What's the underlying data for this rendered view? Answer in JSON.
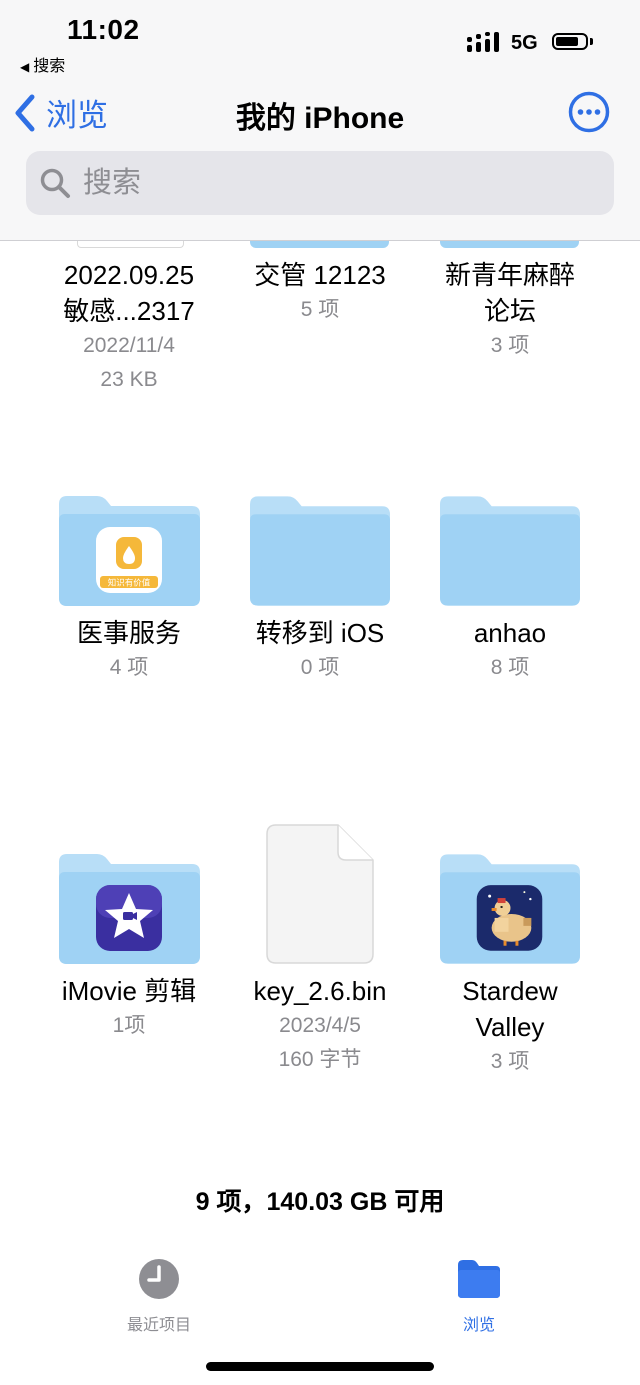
{
  "status_bar": {
    "time": "11:02",
    "back_app": "搜索",
    "network": "5G"
  },
  "nav": {
    "back_label": "浏览",
    "title": "我的 iPhone",
    "more_icon": "ellipsis-circle-icon"
  },
  "search": {
    "placeholder": "搜索",
    "value": ""
  },
  "items": [
    {
      "name_line1": "2022.09.25",
      "name_line2": "敏感...2317",
      "meta1": "2022/11/4",
      "meta2": "23 KB"
    },
    {
      "name_line1": "交管 12123",
      "meta1": "5 项"
    },
    {
      "name_line1": "新青年麻醉",
      "name_line2": "论坛",
      "meta1": "3 项"
    },
    {
      "name_line1": "医事服务",
      "meta1": "4 项",
      "badge": "知识有价值"
    },
    {
      "name_line1": "转移到 iOS",
      "meta1": "0 项"
    },
    {
      "name_line1": "anhao",
      "meta1": "8 项"
    },
    {
      "name_line1": "iMovie 剪辑",
      "meta1": "1项"
    },
    {
      "name_line1": "key_2.6.bin",
      "meta1": "2023/4/5",
      "meta2": "160 字节"
    },
    {
      "name_line1": "Stardew",
      "name_line2": "Valley",
      "meta1": "3 项"
    }
  ],
  "footer": {
    "storage": "9 项，140.03 GB 可用"
  },
  "tabs": [
    {
      "label": "最近项目",
      "active": false
    },
    {
      "label": "浏览",
      "active": true
    }
  ],
  "colors": {
    "accent": "#2f6fe4",
    "folder": "#9fd2f4",
    "folder_back": "#b8def7"
  }
}
